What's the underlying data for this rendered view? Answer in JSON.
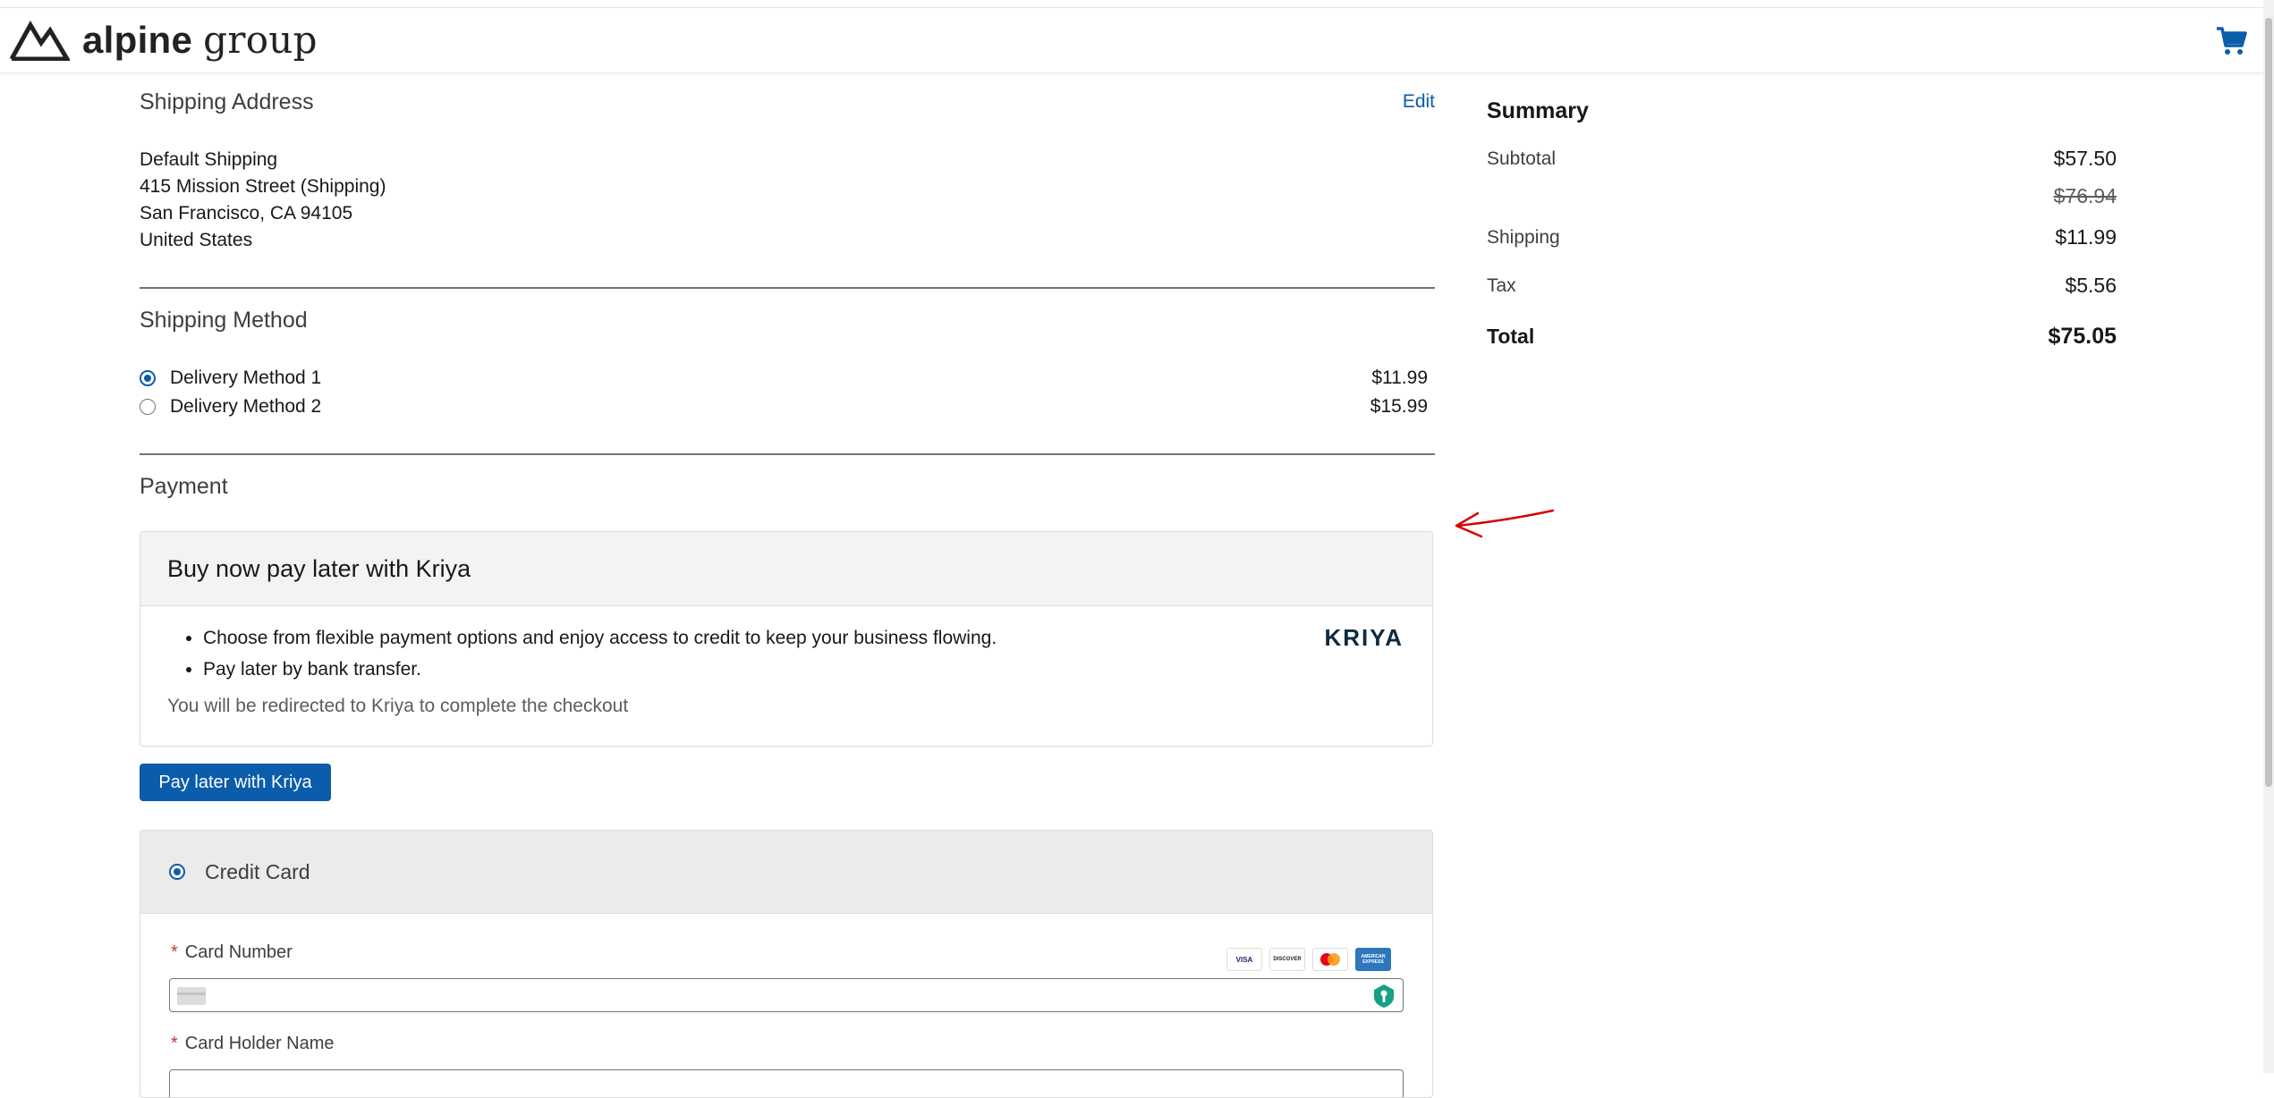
{
  "brand": {
    "name_bold": "alpine",
    "name_light": "group"
  },
  "icons": {
    "logo": "mountain-logo-icon",
    "cart": "shopping-cart-icon",
    "card_placeholder": "credit-card-icon",
    "secure_key": "key-shield-icon",
    "annotation": "red-arrow-annotation"
  },
  "colors": {
    "accent": "#0b5cab",
    "annotation": "#d60000",
    "required": "#c23934",
    "secure_badge": "#16a085"
  },
  "shipping_address": {
    "title": "Shipping Address",
    "edit_label": "Edit",
    "lines": [
      "Default Shipping",
      "415 Mission Street (Shipping)",
      "San Francisco, CA 94105",
      "United States"
    ]
  },
  "shipping_method": {
    "title": "Shipping Method",
    "options": [
      {
        "label": "Delivery Method 1",
        "price": "$11.99",
        "selected": true
      },
      {
        "label": "Delivery Method 2",
        "price": "$15.99",
        "selected": false
      }
    ]
  },
  "payment": {
    "title": "Payment",
    "kriya": {
      "heading": "Buy now pay later with Kriya",
      "logo_text": "KRIYA",
      "bullets": [
        "Choose from flexible payment options and enjoy access to credit to keep your business flowing.",
        "Pay later by bank transfer."
      ],
      "note": "You will be redirected to Kriya to complete the checkout",
      "button_label": "Pay later with Kriya"
    },
    "credit_card": {
      "label": "Credit Card",
      "selected": true,
      "card_number_label": "Card Number",
      "card_holder_label": "Card Holder Name",
      "required_mark": "*",
      "card_number_value": "",
      "card_holder_value": "",
      "brands": [
        "VISA",
        "DISCOVER",
        "mastercard",
        "AMERICAN EXPRESS"
      ]
    }
  },
  "summary": {
    "title": "Summary",
    "subtotal_label": "Subtotal",
    "subtotal": "$57.50",
    "original_price": "$76.94",
    "shipping_label": "Shipping",
    "shipping": "$11.99",
    "tax_label": "Tax",
    "tax": "$5.56",
    "total_label": "Total",
    "total": "$75.05"
  }
}
